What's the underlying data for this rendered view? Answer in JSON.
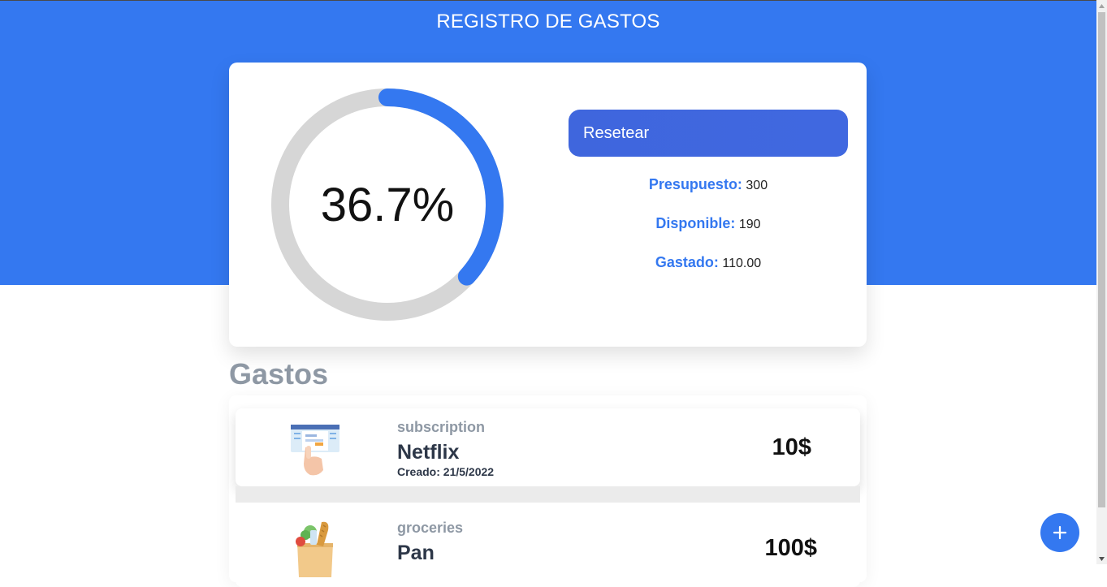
{
  "header": {
    "title": "REGISTRO DE GASTOS"
  },
  "budget": {
    "percent_text": "36.7%",
    "percent_value": 36.7,
    "reset_label": "Resetear",
    "presupuesto_label": "Presupuesto:",
    "presupuesto_value": "300",
    "disponible_label": "Disponible:",
    "disponible_value": "190",
    "gastado_label": "Gastado:",
    "gastado_value": "110.00"
  },
  "expenses": {
    "heading": "Gastos",
    "items": [
      {
        "category": "subscription",
        "name": "Netflix",
        "date": "Creado: 21/5/2022",
        "amount": "10$",
        "icon": "subscription-icon"
      },
      {
        "category": "groceries",
        "name": "Pan",
        "date": "",
        "amount": "100$",
        "icon": "groceries-bag-icon"
      }
    ]
  },
  "fab": {
    "icon": "plus-icon"
  },
  "colors": {
    "accent": "#3478f0",
    "button": "#4068e0",
    "ring_track": "#d6d6d6",
    "muted": "#8e98a4"
  }
}
